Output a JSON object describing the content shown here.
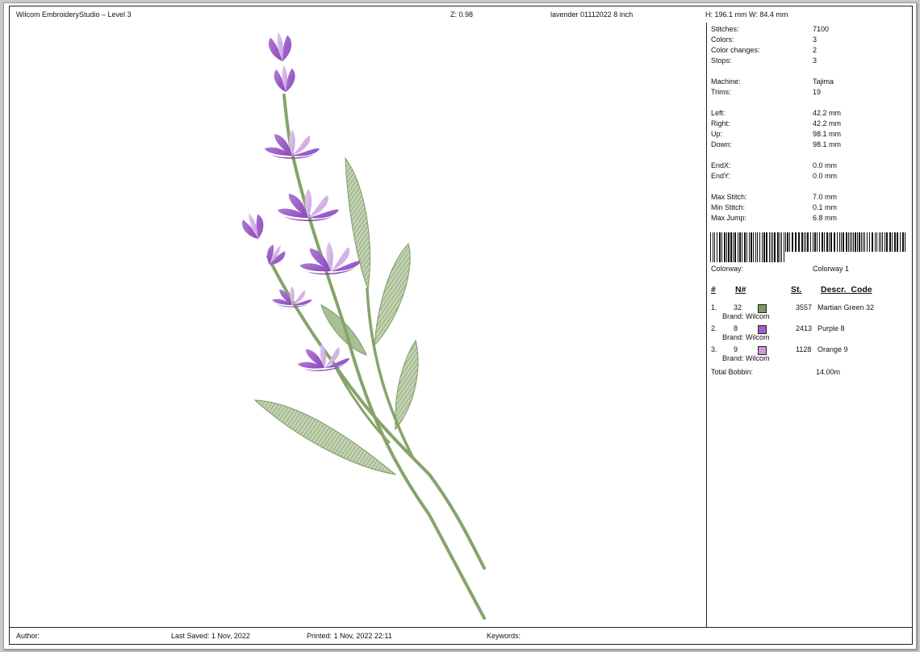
{
  "header": {
    "app_title": "Wilcom EmbroideryStudio – Level 3",
    "zoom": "Z: 0.98",
    "design_name": "lavender 01112022 8 inch",
    "size": "H: 196.1 mm   W: 84.4 mm"
  },
  "stats": [
    {
      "label": "Stitches:",
      "value": "7100"
    },
    {
      "label": "Colors:",
      "value": "3"
    },
    {
      "label": "Color changes:",
      "value": "2"
    },
    {
      "label": "Stops:",
      "value": "3"
    },
    {
      "label": "Machine:",
      "value": "Tajima"
    },
    {
      "label": "Trims:",
      "value": "19"
    },
    {
      "label": "Left:",
      "value": "42.2 mm"
    },
    {
      "label": "Right:",
      "value": "42.2 mm"
    },
    {
      "label": "Up:",
      "value": "98.1 mm"
    },
    {
      "label": "Down:",
      "value": "98.1 mm"
    },
    {
      "label": "EndX:",
      "value": "0.0 mm"
    },
    {
      "label": "EndY:",
      "value": "0.0 mm"
    },
    {
      "label": "Max Stitch:",
      "value": "7.0 mm"
    },
    {
      "label": "Min Stitch:",
      "value": "0.1 mm"
    },
    {
      "label": "Max Jump:",
      "value": "6.8 mm"
    }
  ],
  "colorway": {
    "label": "Colorway:",
    "value": "Colorway 1"
  },
  "color_table": {
    "headers": {
      "index": "#",
      "number": "N#",
      "stitches": "St.",
      "description": "Descr._Code"
    },
    "rows": [
      {
        "index": "1.",
        "number": "32",
        "color": "#7a9a5e",
        "stitches": "3557",
        "description": "Martian Green 32",
        "brand": "Brand: Wilcom"
      },
      {
        "index": "2.",
        "number": "8",
        "color": "#a55cc8",
        "stitches": "2413",
        "description": "Purple 8",
        "brand": "Brand: Wilcom"
      },
      {
        "index": "3.",
        "number": "9",
        "color": "#cf9ad8",
        "stitches": "1128",
        "description": "Orange 9",
        "brand": "Brand: Wilcom"
      }
    ]
  },
  "bobbin": {
    "label": "Total Bobbin:",
    "value": "14.00m"
  },
  "footer": {
    "author": "Author:",
    "last_saved": "Last Saved:  1 Nov, 2022",
    "printed": "Printed:  1 Nov, 2022 22:11",
    "keywords": "Keywords:"
  },
  "colors": {
    "leaf_green": "#8aa672",
    "stem_green": "#86a46a",
    "purple_dark": "#9a54c4",
    "purple_light": "#d2b2e4"
  }
}
